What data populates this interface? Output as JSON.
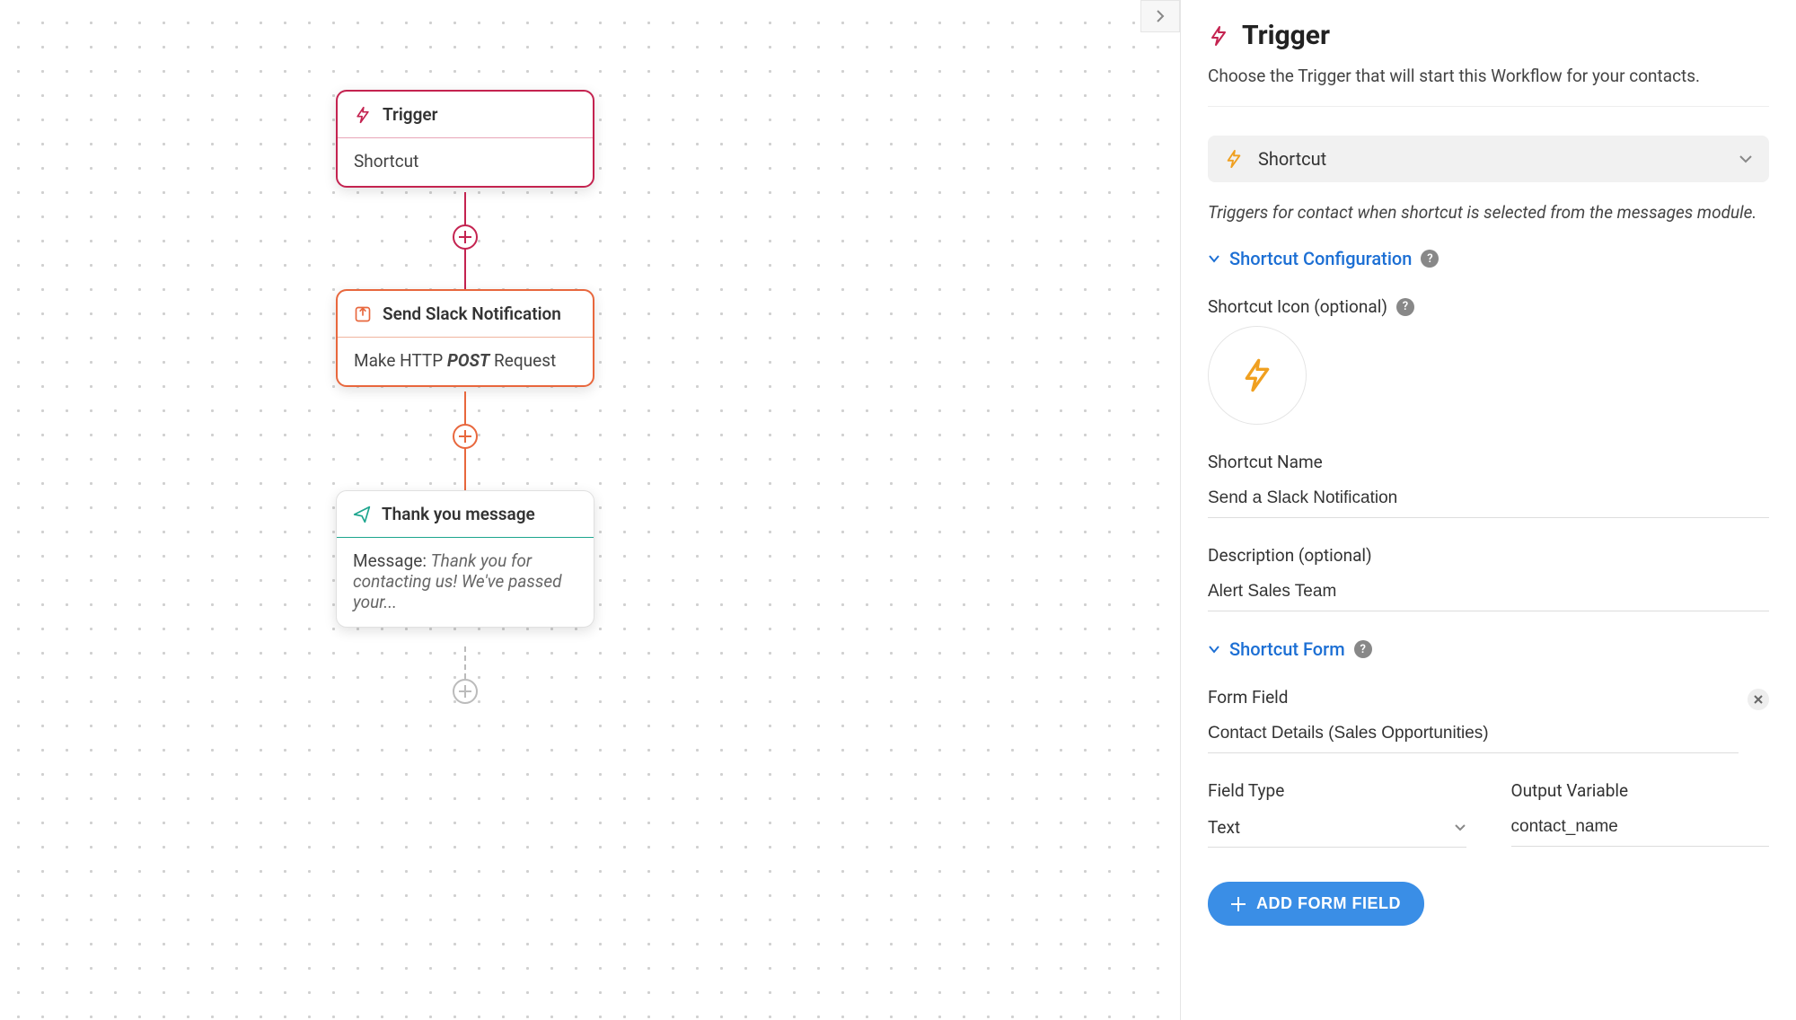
{
  "canvas": {
    "nodes": {
      "trigger": {
        "title": "Trigger",
        "body": "Shortcut"
      },
      "slack": {
        "title": "Send Slack Notification",
        "body_prefix": "Make HTTP ",
        "body_method": "POST",
        "body_suffix": " Request"
      },
      "thanks": {
        "title": "Thank you message",
        "body_prefix": "Message: ",
        "body_msg": "Thank you for contacting us! We've passed your..."
      }
    }
  },
  "sidebar": {
    "title": "Trigger",
    "subtitle": "Choose the Trigger that will start this Workflow for your contacts.",
    "shortcut_label": "Shortcut",
    "trigger_description": "Triggers for contact when shortcut is selected from the messages module.",
    "sections": {
      "config": {
        "title": "Shortcut Configuration"
      },
      "form": {
        "title": "Shortcut Form"
      }
    },
    "fields": {
      "icon_label": "Shortcut Icon (optional)",
      "name_label": "Shortcut Name",
      "name_value": "Send a Slack Notification",
      "desc_label": "Description (optional)",
      "desc_value": "Alert Sales Team",
      "form_field_label": "Form Field",
      "form_field_value": "Contact Details (Sales Opportunities)",
      "field_type_label": "Field Type",
      "field_type_value": "Text",
      "output_var_label": "Output Variable",
      "output_var_value": "contact_name"
    },
    "add_button": "ADD FORM FIELD"
  },
  "colors": {
    "crimson": "#c42350",
    "orange": "#e8673d",
    "teal": "#1da58e",
    "amber": "#f0a020",
    "blue": "#1c6fd4",
    "btnblue": "#3a8ee6"
  }
}
